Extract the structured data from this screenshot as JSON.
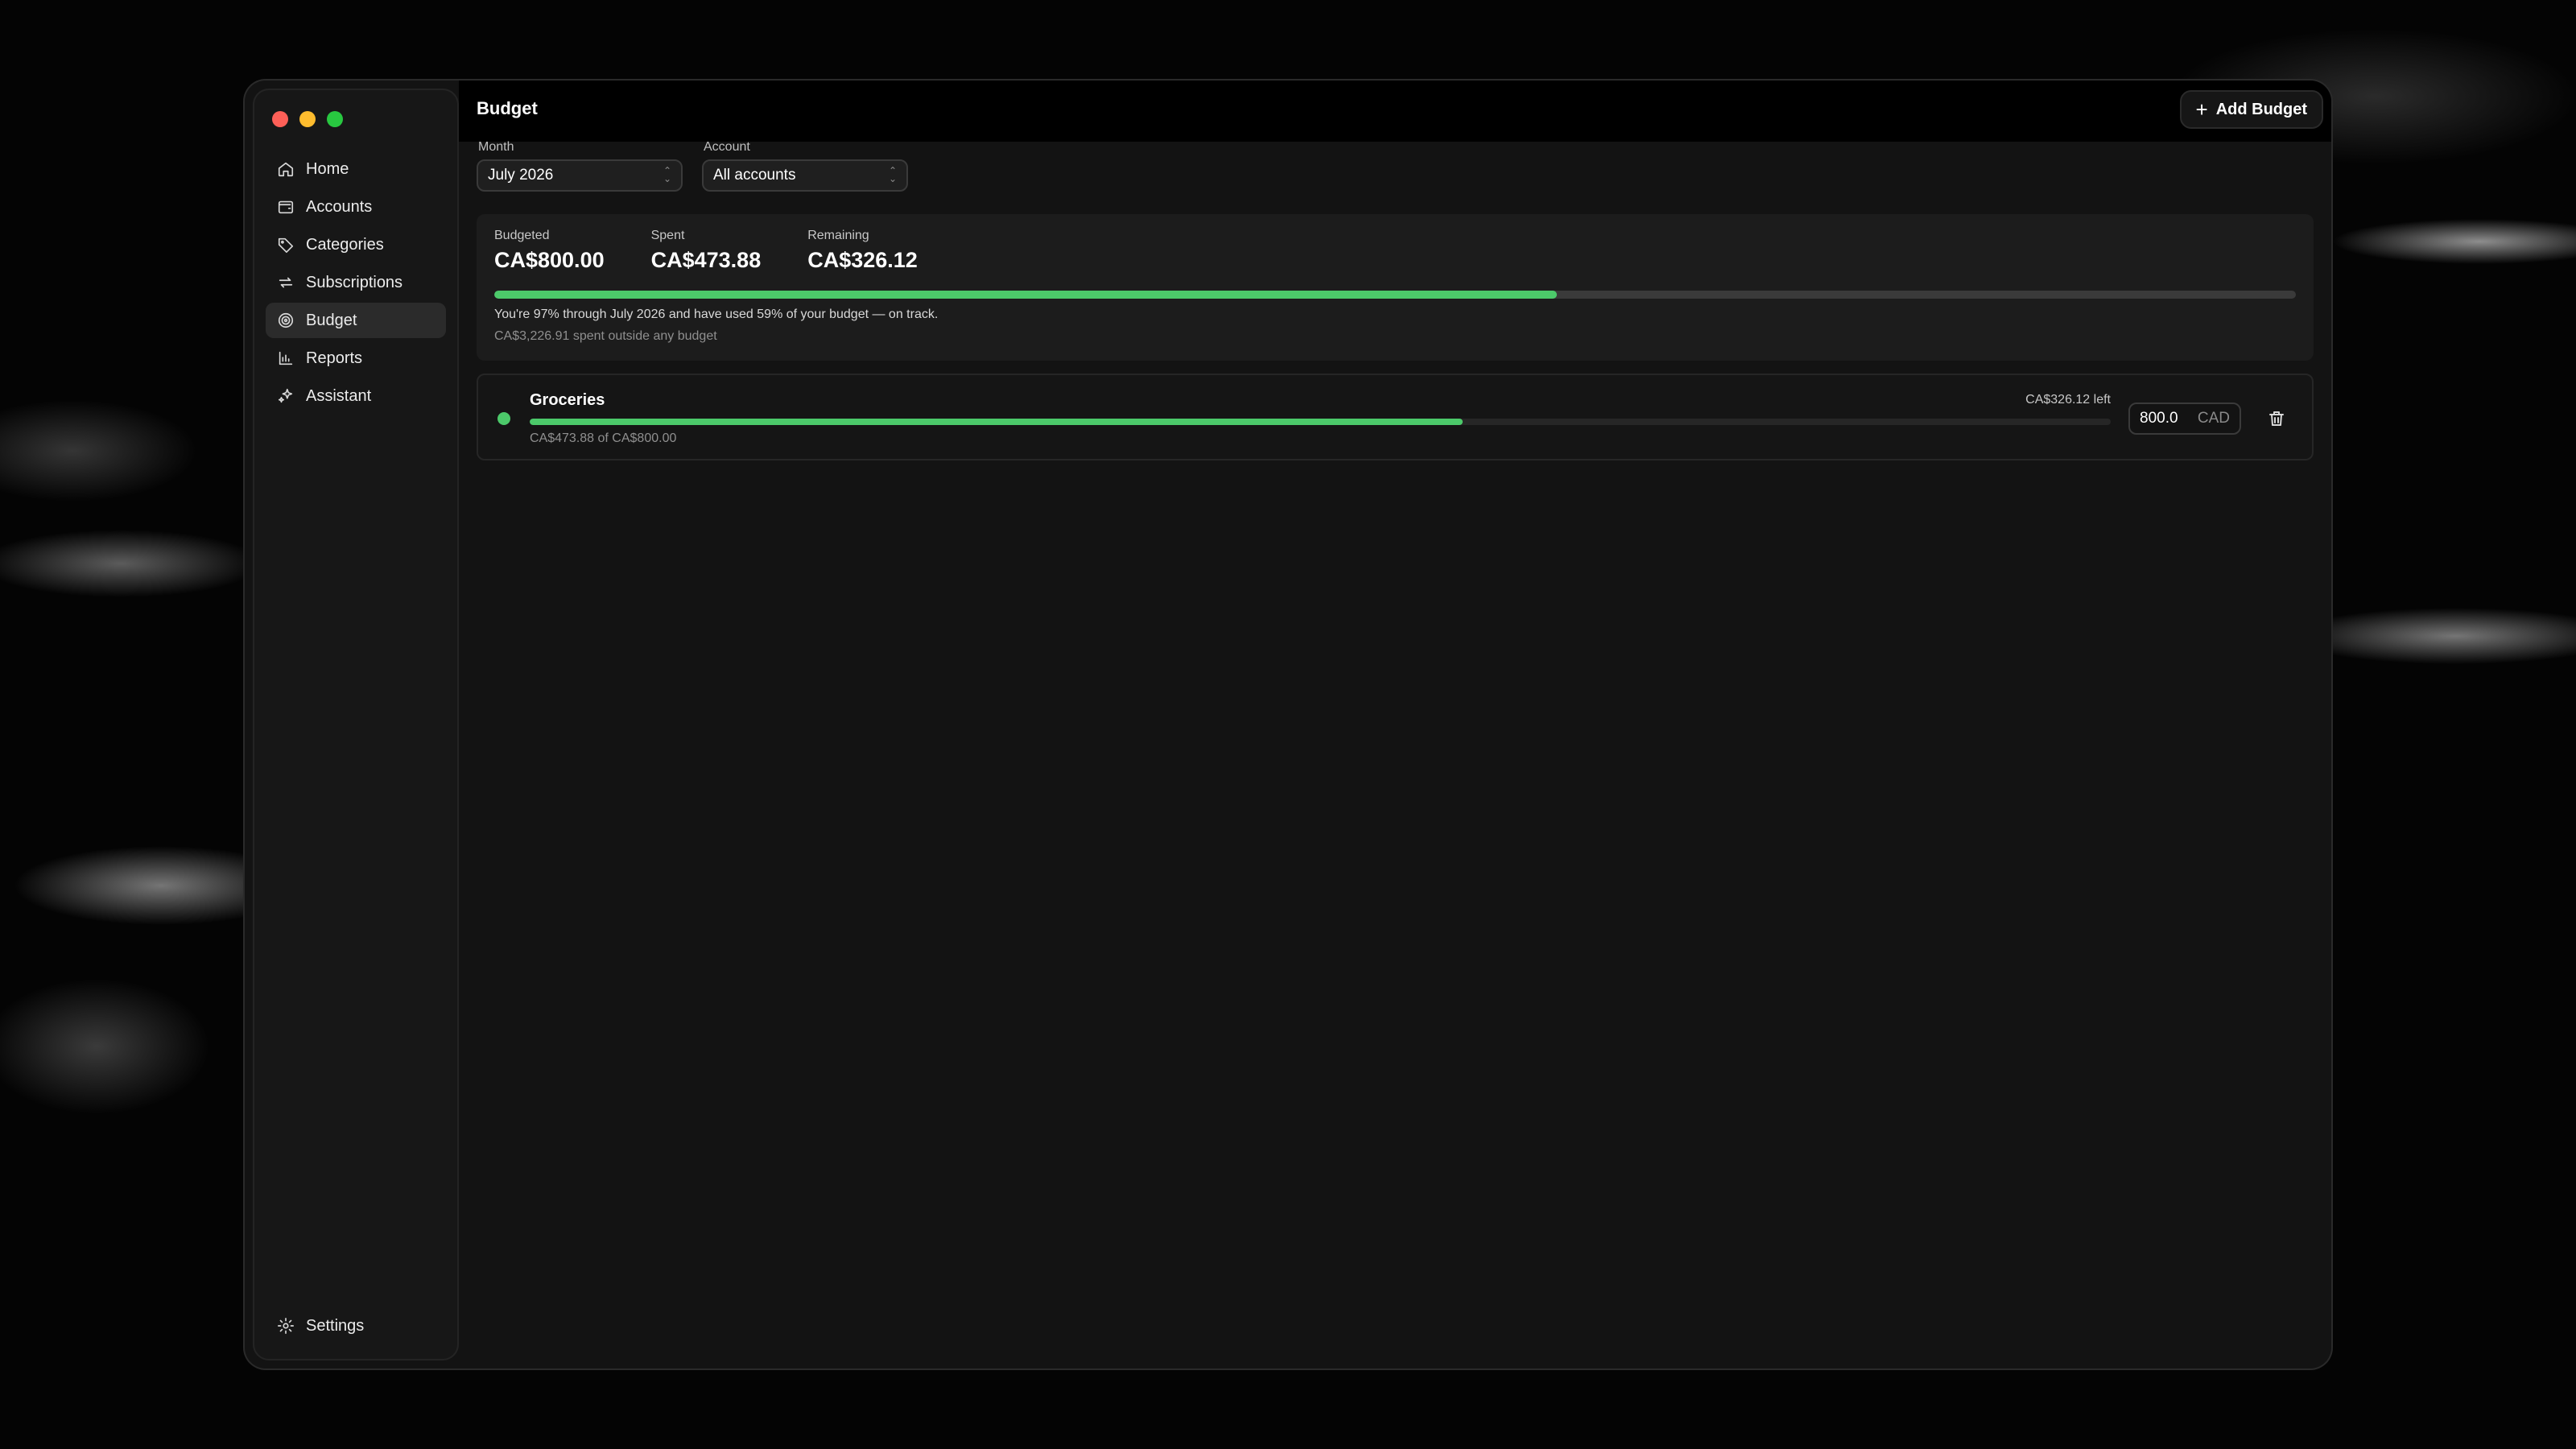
{
  "sidebar": {
    "items": [
      {
        "label": "Home",
        "icon": "home-icon"
      },
      {
        "label": "Accounts",
        "icon": "wallet-icon"
      },
      {
        "label": "Categories",
        "icon": "tag-icon"
      },
      {
        "label": "Subscriptions",
        "icon": "repeat-icon"
      },
      {
        "label": "Budget",
        "icon": "target-icon",
        "active": true
      },
      {
        "label": "Reports",
        "icon": "bar-chart-icon"
      },
      {
        "label": "Assistant",
        "icon": "sparkles-icon"
      }
    ],
    "settings": {
      "label": "Settings",
      "icon": "gear-icon"
    }
  },
  "header": {
    "title": "Budget",
    "add_button": "Add Budget"
  },
  "filters": {
    "month": {
      "label": "Month",
      "value": "July 2026"
    },
    "account": {
      "label": "Account",
      "value": "All accounts"
    }
  },
  "summary": {
    "budgeted": {
      "label": "Budgeted",
      "value": "CA$800.00"
    },
    "spent": {
      "label": "Spent",
      "value": "CA$473.88"
    },
    "remaining": {
      "label": "Remaining",
      "value": "CA$326.12"
    },
    "progress": 0.59,
    "pace_text": "You're 97% through July 2026 and have used 59% of your budget — on track.",
    "outside_text": "CA$3,226.91 spent outside any budget"
  },
  "budgets": [
    {
      "name": "Groceries",
      "left_text": "CA$326.12 left",
      "progress": 0.59,
      "sub_text": "CA$473.88 of CA$800.00",
      "amount": "800.0",
      "currency": "CAD",
      "status_color": "#4cc96a"
    }
  ],
  "colors": {
    "accent": "#4cc96a",
    "close": "#fe5f57",
    "minimize": "#febc2e",
    "maximize": "#28c840"
  }
}
